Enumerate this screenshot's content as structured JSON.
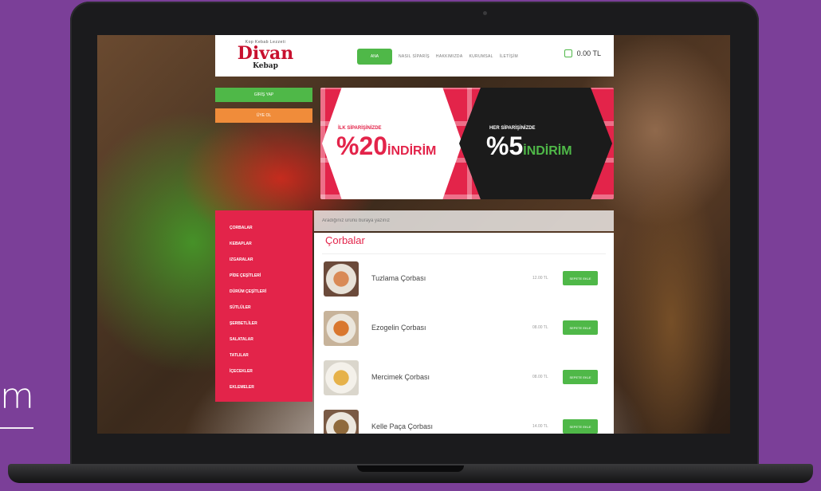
{
  "backdrop": {
    "partial_text": "m"
  },
  "site": {
    "logo": {
      "tagline": "Kop Kebab Lezzeti",
      "name": "Divan",
      "sub": "Kebap"
    },
    "nav": {
      "active": "ANA",
      "items": [
        "NASIL SİPARİŞ",
        "HAKKIMIZDA",
        "KURUMSAL",
        "İLETİŞİM"
      ]
    },
    "cart": {
      "total": "0.00 TL"
    },
    "buttons": {
      "green": "GİRİŞ YAP",
      "orange": "ÜYE OL"
    },
    "banner": {
      "left": {
        "caption": "İLK SİPARİŞİNİZDE",
        "percent": "%20",
        "word": "İNDİRİM"
      },
      "right": {
        "caption": "HER SİPARİŞİNİZDE",
        "percent": "%5",
        "word": "İNDİRİM"
      }
    },
    "sidebar": {
      "items": [
        "ÇORBALAR",
        "KEBAPLAR",
        "IZGARALAR",
        "PİDE ÇEŞİTLERİ",
        "DÜRÜM ÇEŞİTLERİ",
        "SÜTLÜLER",
        "ŞERBETLİLER",
        "SALATALAR",
        "TATLILAR",
        "İÇECEKLER",
        "EKLEMELER"
      ]
    },
    "search": {
      "placeholder": "Aradığınız ürünü buraya yazınız"
    },
    "menu": {
      "title": "Çorbalar",
      "products": [
        {
          "name": "Tuzlama Çorbası",
          "price": "12.00 TL",
          "button": "SEPETE EKLE"
        },
        {
          "name": "Ezogelin Çorbası",
          "price": "08.00 TL",
          "button": "SEPETE EKLE"
        },
        {
          "name": "Mercimek Çorbası",
          "price": "08.00 TL",
          "button": "SEPETE EKLE"
        },
        {
          "name": "Kelle Paça Çorbası",
          "price": "14.00 TL",
          "button": "SEPETE EKLE"
        }
      ]
    }
  }
}
